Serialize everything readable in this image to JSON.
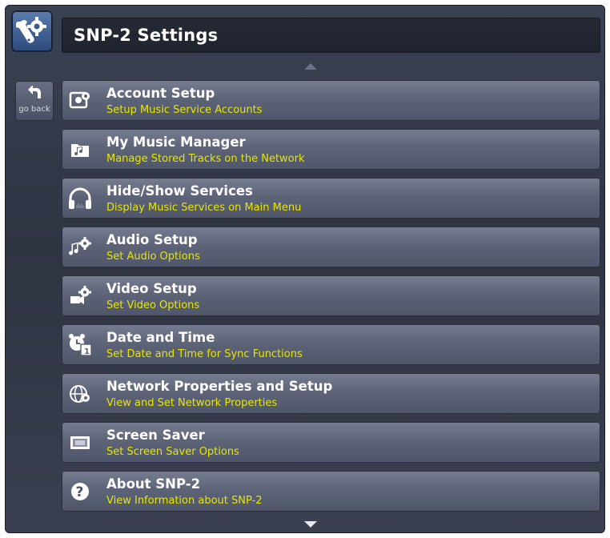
{
  "header": {
    "title": "SNP-2 Settings"
  },
  "nav": {
    "go_back_label": "go back"
  },
  "menu": {
    "items": [
      {
        "title": "Account Setup",
        "subtitle": "Setup Music Service Accounts",
        "icon": "account-setup-icon"
      },
      {
        "title": "My Music Manager",
        "subtitle": "Manage Stored Tracks on the Network",
        "icon": "music-folder-icon"
      },
      {
        "title": "Hide/Show Services",
        "subtitle": "Display Music Services on Main Menu",
        "icon": "headphones-icon"
      },
      {
        "title": "Audio Setup",
        "subtitle": "Set Audio Options",
        "icon": "audio-gear-icon"
      },
      {
        "title": "Video Setup",
        "subtitle": "Set Video Options",
        "icon": "video-gear-icon"
      },
      {
        "title": "Date and Time",
        "subtitle": "Set Date and Time for Sync Functions",
        "icon": "clock-calendar-icon"
      },
      {
        "title": "Network Properties and Setup",
        "subtitle": "View and Set Network Properties",
        "icon": "network-globe-icon"
      },
      {
        "title": "Screen Saver",
        "subtitle": "Set Screen Saver Options",
        "icon": "screen-saver-icon"
      },
      {
        "title": "About SNP-2",
        "subtitle": "View Information about SNP-2",
        "icon": "question-icon"
      }
    ]
  },
  "colors": {
    "subtitle": "#e6e600",
    "title": "#ffffff",
    "background": "#333847"
  }
}
